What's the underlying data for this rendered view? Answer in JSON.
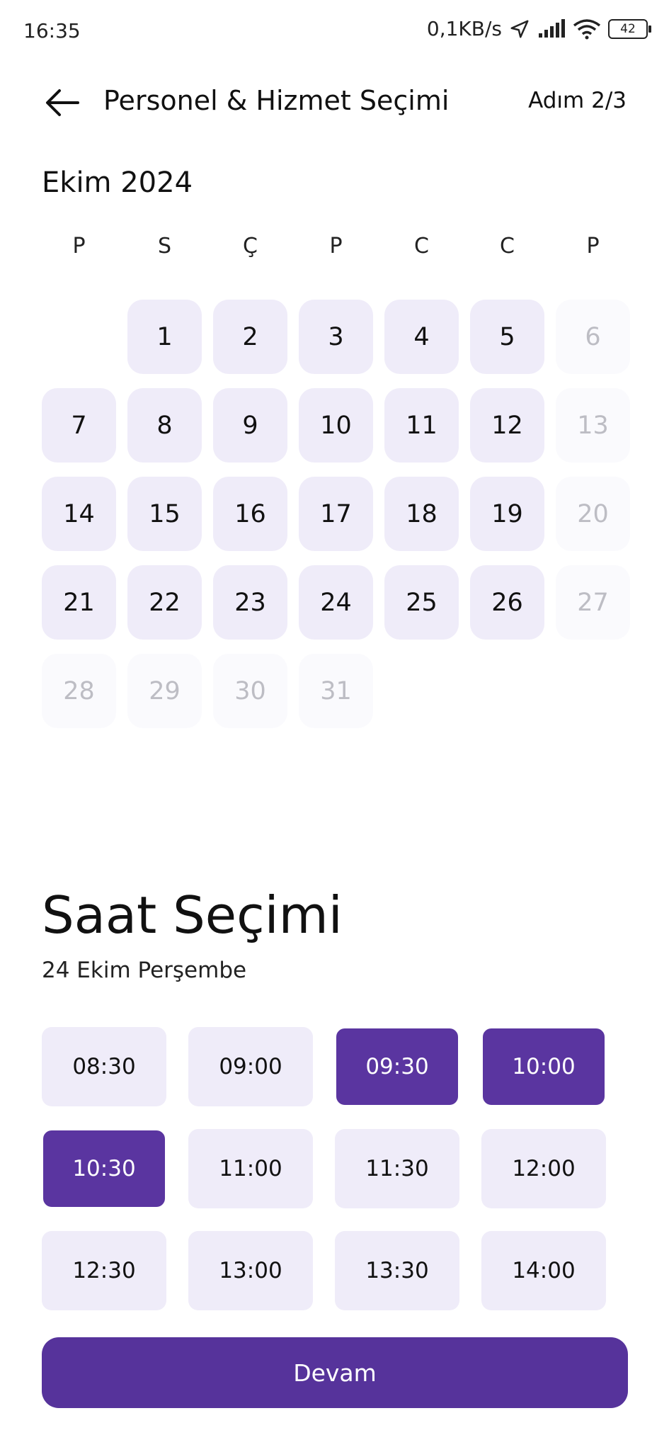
{
  "status_bar": {
    "time": "16:35",
    "network_speed": "0,1KB/s",
    "battery": "42",
    "icons": [
      "location-arrow-icon",
      "signal-icon",
      "wifi-icon",
      "battery-icon"
    ]
  },
  "header": {
    "back_icon": "arrow-left-icon",
    "title": "Personel & Hizmet Seçimi",
    "step": "Adım 2/3"
  },
  "calendar": {
    "month_title": "Ekim 2024",
    "weekdays": [
      "P",
      "S",
      "Ç",
      "P",
      "C",
      "C",
      "P"
    ],
    "days": [
      {
        "day": "1",
        "available": true
      },
      {
        "day": "2",
        "available": true
      },
      {
        "day": "3",
        "available": true
      },
      {
        "day": "4",
        "available": true
      },
      {
        "day": "5",
        "available": true
      },
      {
        "day": "6",
        "available": false
      },
      {
        "day": "7",
        "available": true
      },
      {
        "day": "8",
        "available": true
      },
      {
        "day": "9",
        "available": true
      },
      {
        "day": "10",
        "available": true
      },
      {
        "day": "11",
        "available": true
      },
      {
        "day": "12",
        "available": true
      },
      {
        "day": "13",
        "available": false
      },
      {
        "day": "14",
        "available": true
      },
      {
        "day": "15",
        "available": true
      },
      {
        "day": "16",
        "available": true
      },
      {
        "day": "17",
        "available": true
      },
      {
        "day": "18",
        "available": true
      },
      {
        "day": "19",
        "available": true
      },
      {
        "day": "20",
        "available": false
      },
      {
        "day": "21",
        "available": true
      },
      {
        "day": "22",
        "available": true
      },
      {
        "day": "23",
        "available": true
      },
      {
        "day": "24",
        "available": true
      },
      {
        "day": "25",
        "available": true
      },
      {
        "day": "26",
        "available": true
      },
      {
        "day": "27",
        "available": false
      },
      {
        "day": "28",
        "available": false
      },
      {
        "day": "29",
        "available": false
      },
      {
        "day": "30",
        "available": false
      },
      {
        "day": "31",
        "available": false
      }
    ]
  },
  "time_selection": {
    "title": "Saat Seçimi",
    "selected_date": "24 Ekim Perşembe",
    "slots": [
      {
        "time": "08:30",
        "selected": false
      },
      {
        "time": "09:00",
        "selected": false
      },
      {
        "time": "09:30",
        "selected": true
      },
      {
        "time": "10:00",
        "selected": true
      },
      {
        "time": "10:30",
        "selected": true
      },
      {
        "time": "11:00",
        "selected": false
      },
      {
        "time": "11:30",
        "selected": false
      },
      {
        "time": "12:00",
        "selected": false
      },
      {
        "time": "12:30",
        "selected": false
      },
      {
        "time": "13:00",
        "selected": false
      },
      {
        "time": "13:30",
        "selected": false
      },
      {
        "time": "14:00",
        "selected": false
      }
    ]
  },
  "continue_button": {
    "label": "Devam"
  },
  "colors": {
    "accent": "#56339b",
    "chip_background": "#efecf9",
    "disabled_text": "#bdbdc4"
  }
}
